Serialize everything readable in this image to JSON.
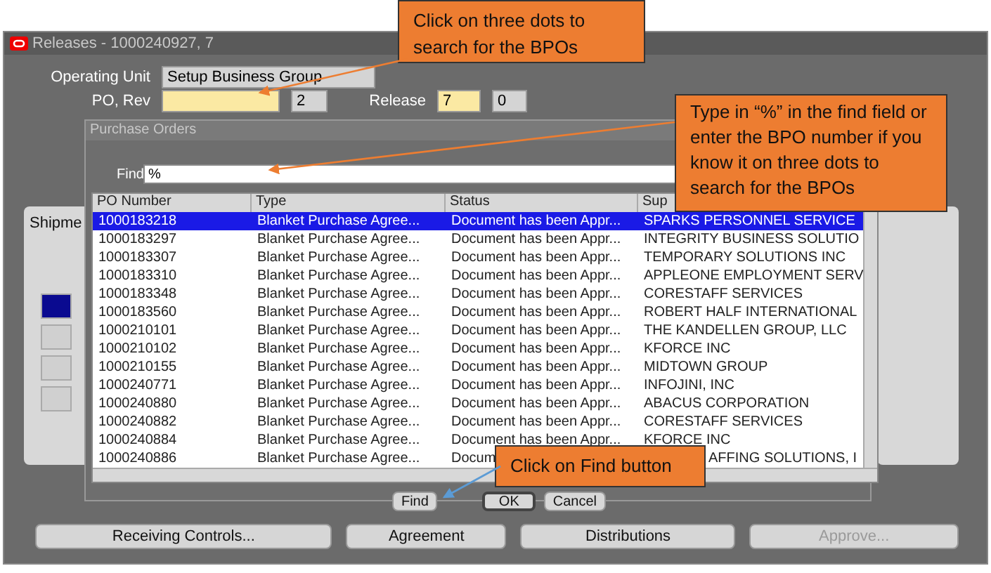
{
  "window": {
    "title": "Releases - 1000240927, 7"
  },
  "form": {
    "operating_unit_label": "Operating Unit",
    "operating_unit": "Setup Business Group",
    "po_rev_label": "PO, Rev",
    "rev": "2",
    "release_label": "Release",
    "release": "7",
    "release_rev": "0"
  },
  "shipments_tab": "Shipme",
  "dialog": {
    "title": "Purchase Orders",
    "find_label": "Find",
    "find_value": "%",
    "columns": [
      "PO Number",
      "Type",
      "Status",
      "Sup"
    ],
    "rows": [
      {
        "po": "1000183218",
        "type": "Blanket Purchase Agree...",
        "status": "Document has been Appr...",
        "supplier": "SPARKS PERSONNEL SERVICE",
        "selected": true
      },
      {
        "po": "1000183297",
        "type": "Blanket Purchase Agree...",
        "status": "Document has been Appr...",
        "supplier": "INTEGRITY BUSINESS SOLUTIO",
        "selected": false
      },
      {
        "po": "1000183307",
        "type": "Blanket Purchase Agree...",
        "status": "Document has been Appr...",
        "supplier": "TEMPORARY SOLUTIONS INC",
        "selected": false
      },
      {
        "po": "1000183310",
        "type": "Blanket Purchase Agree...",
        "status": "Document has been Appr...",
        "supplier": "APPLEONE EMPLOYMENT SERV",
        "selected": false
      },
      {
        "po": "1000183348",
        "type": "Blanket Purchase Agree...",
        "status": "Document has been Appr...",
        "supplier": "CORESTAFF SERVICES",
        "selected": false
      },
      {
        "po": "1000183560",
        "type": "Blanket Purchase Agree...",
        "status": "Document has been Appr...",
        "supplier": "ROBERT HALF INTERNATIONAL",
        "selected": false
      },
      {
        "po": "1000210101",
        "type": "Blanket Purchase Agree...",
        "status": "Document has been Appr...",
        "supplier": "THE KANDELLEN GROUP, LLC",
        "selected": false
      },
      {
        "po": "1000210102",
        "type": "Blanket Purchase Agree...",
        "status": "Document has been Appr...",
        "supplier": "KFORCE INC",
        "selected": false
      },
      {
        "po": "1000210155",
        "type": "Blanket Purchase Agree...",
        "status": "Document has been Appr...",
        "supplier": "MIDTOWN GROUP",
        "selected": false
      },
      {
        "po": "1000240771",
        "type": "Blanket Purchase Agree...",
        "status": "Document has been Appr...",
        "supplier": "INFOJINI, INC",
        "selected": false
      },
      {
        "po": "1000240880",
        "type": "Blanket Purchase Agree...",
        "status": "Document has been Appr...",
        "supplier": "ABACUS CORPORATION",
        "selected": false
      },
      {
        "po": "1000240882",
        "type": "Blanket Purchase Agree...",
        "status": "Document has been Appr...",
        "supplier": "CORESTAFF SERVICES",
        "selected": false
      },
      {
        "po": "1000240884",
        "type": "Blanket Purchase Agree...",
        "status": "Document has been Appr...",
        "supplier": "KFORCE INC",
        "selected": false
      },
      {
        "po": "1000240886",
        "type": "Blanket Purchase Agree...",
        "status": "Docum",
        "supplier": "AFFING SOLUTIONS, I",
        "selected": false,
        "covered": true
      }
    ],
    "buttons": [
      {
        "label": "Find",
        "kind": "plain"
      },
      {
        "label": "OK",
        "kind": "default"
      },
      {
        "label": "Cancel",
        "kind": "plain"
      }
    ]
  },
  "bottom_buttons": [
    {
      "label": "Receiving Controls...",
      "disabled": false
    },
    {
      "label": "Agreement",
      "disabled": false
    },
    {
      "label": "Distributions",
      "disabled": false
    },
    {
      "label": "Approve...",
      "disabled": true
    }
  ],
  "callouts": [
    "Click on three dots to search for the BPOs",
    "Type in “%” in the find field or enter the BPO number if you know it on three dots to search for the BPOs",
    "Click on Find button"
  ]
}
